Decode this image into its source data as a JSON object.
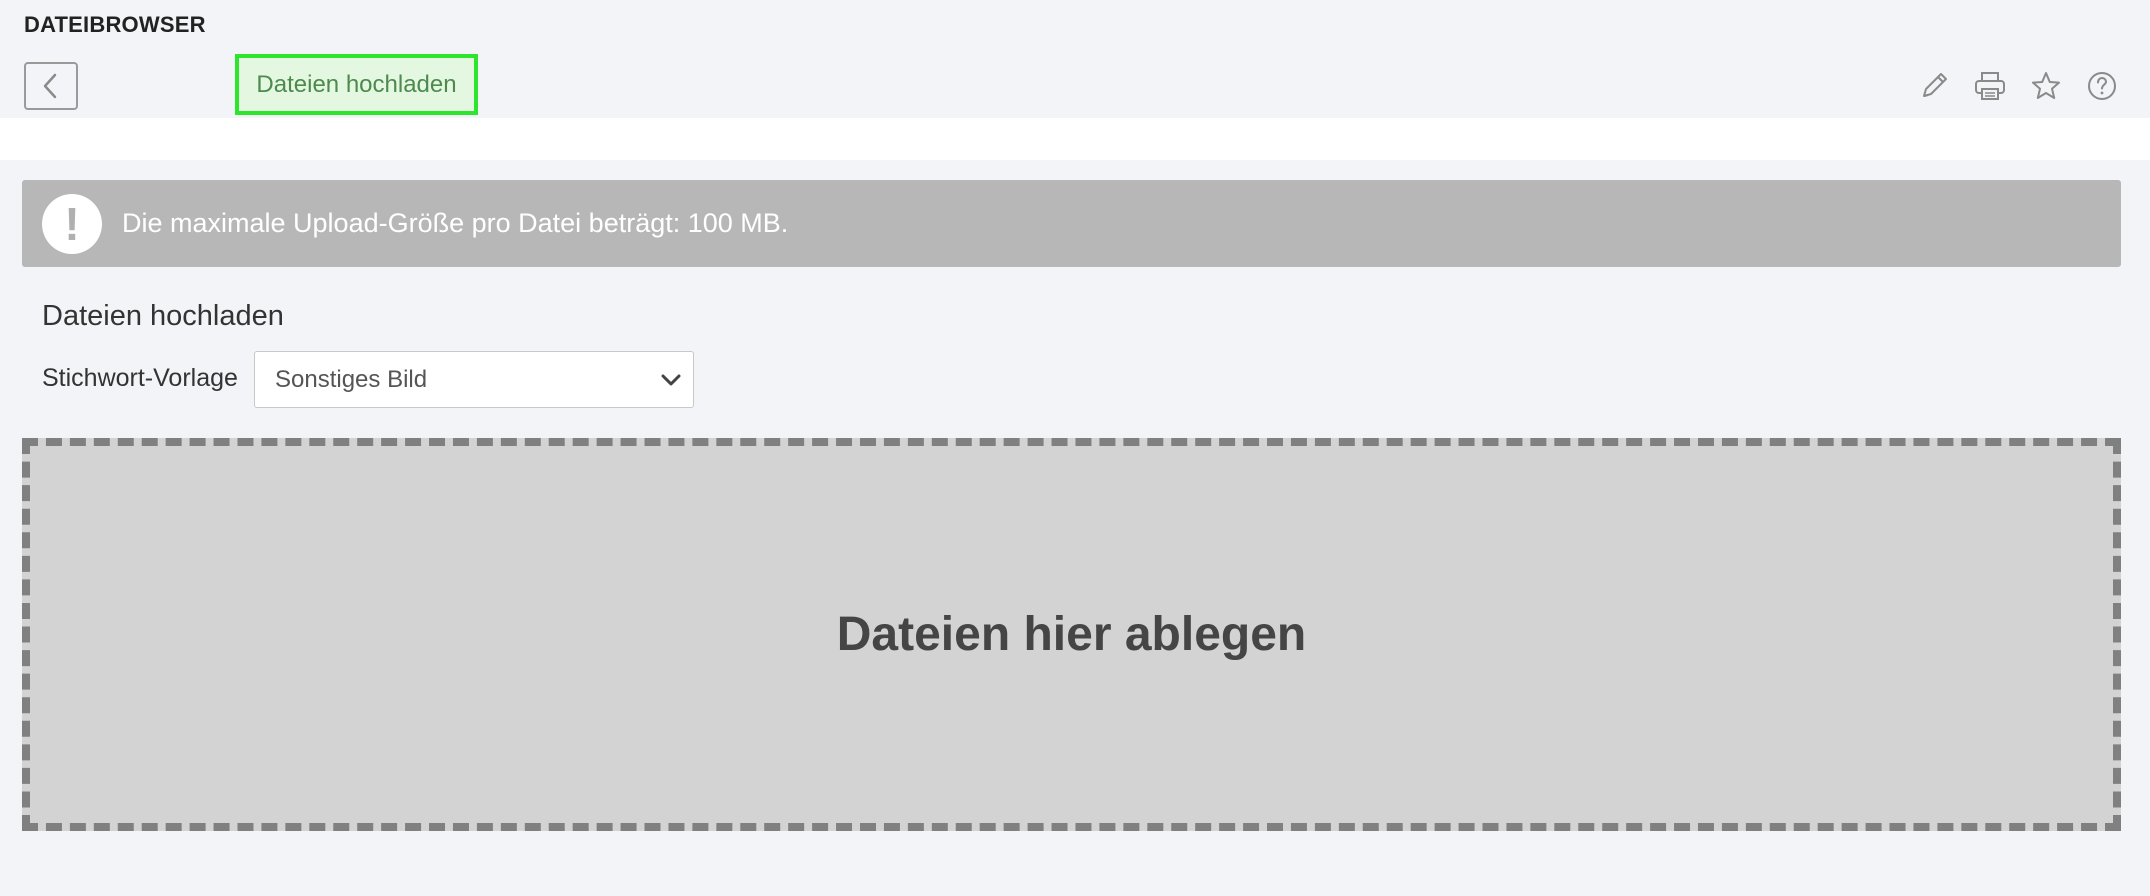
{
  "header": {
    "app_title": "DATEIBROWSER",
    "active_tab_label": "Dateien hochladen",
    "active_tab_highlight_color": "#2ee52e",
    "toolbar_icons": [
      "back-icon",
      "pencil-icon",
      "print-icon",
      "star-icon",
      "help-icon"
    ]
  },
  "alert": {
    "icon": "exclamation-icon",
    "text": "Die maximale Upload-Größe pro Datei beträgt: 100 MB.",
    "background": "#b7b7b7"
  },
  "upload": {
    "title": "Dateien hochladen",
    "keyword_template_label": "Stichwort-Vorlage",
    "keyword_template_value": "Sonstiges Bild",
    "dropzone_text": "Dateien hier ablegen"
  }
}
